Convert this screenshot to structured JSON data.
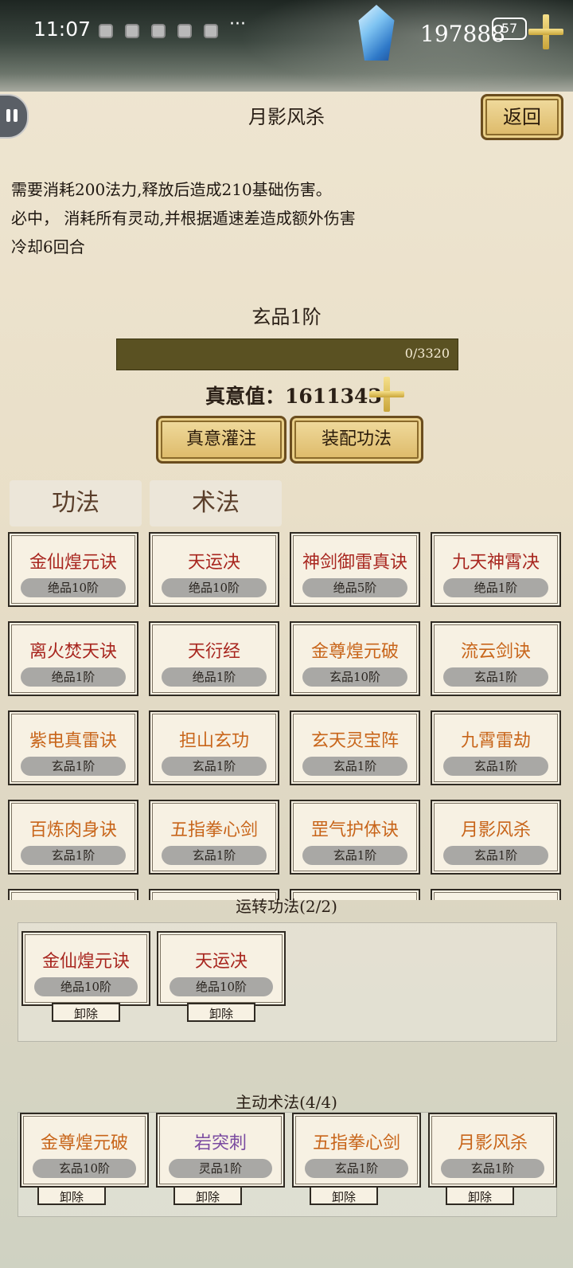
{
  "status_bar": {
    "time": "11:07",
    "more": "···",
    "battery": "57"
  },
  "currency": {
    "amount": "197888"
  },
  "header": {
    "title": "月影风杀",
    "back_label": "返回"
  },
  "skill": {
    "description": [
      "需要消耗200法力,释放后造成210基础伤害。",
      "必中， 消耗所有灵动,并根据遁速差造成额外伤害",
      "冷却6回合"
    ],
    "rank": "玄品1阶",
    "progress_text": "0/3320",
    "progress_fraction": 0.0,
    "true_value_label": "真意值：",
    "true_value": "1611343"
  },
  "actions": {
    "infuse_label": "真意灌注",
    "equip_label": "装配功法"
  },
  "tabs": [
    {
      "label": "功法"
    },
    {
      "label": "术法"
    }
  ],
  "skills_grid": [
    {
      "name": "金仙煌元诀",
      "grade": "绝品10阶",
      "color": "#a8261f"
    },
    {
      "name": "天运决",
      "grade": "绝品10阶",
      "color": "#a8261f"
    },
    {
      "name": "神剑御雷真诀",
      "grade": "绝品5阶",
      "color": "#a8261f"
    },
    {
      "name": "九天神霄决",
      "grade": "绝品1阶",
      "color": "#a8261f"
    },
    {
      "name": "离火焚天诀",
      "grade": "绝品1阶",
      "color": "#a8261f"
    },
    {
      "name": "天衍经",
      "grade": "绝品1阶",
      "color": "#a8261f"
    },
    {
      "name": "金尊煌元破",
      "grade": "玄品10阶",
      "color": "#c8651a"
    },
    {
      "name": "流云剑诀",
      "grade": "玄品1阶",
      "color": "#c8651a"
    },
    {
      "name": "紫电真雷诀",
      "grade": "玄品1阶",
      "color": "#c8651a"
    },
    {
      "name": "担山玄功",
      "grade": "玄品1阶",
      "color": "#c8651a"
    },
    {
      "name": "玄天灵宝阵",
      "grade": "玄品1阶",
      "color": "#c8651a"
    },
    {
      "name": "九霄雷劫",
      "grade": "玄品1阶",
      "color": "#c8651a"
    },
    {
      "name": "百炼肉身诀",
      "grade": "玄品1阶",
      "color": "#c8651a"
    },
    {
      "name": "五指拳心剑",
      "grade": "玄品1阶",
      "color": "#c8651a"
    },
    {
      "name": "罡气护体诀",
      "grade": "玄品1阶",
      "color": "#c8651a"
    },
    {
      "name": "月影风杀",
      "grade": "玄品1阶",
      "color": "#c8651a"
    },
    {
      "name": "",
      "grade": "",
      "color": "#c8651a"
    },
    {
      "name": "",
      "grade": "",
      "color": "#c8651a"
    },
    {
      "name": "",
      "grade": "",
      "color": "#c8651a"
    },
    {
      "name": "",
      "grade": "",
      "color": "#c8651a"
    }
  ],
  "running": {
    "title": "运转功法(2/2)",
    "items": [
      {
        "name": "金仙煌元诀",
        "grade": "绝品10阶",
        "color": "#a8261f",
        "unequip": "卸除"
      },
      {
        "name": "天运决",
        "grade": "绝品10阶",
        "color": "#a8261f",
        "unequip": "卸除"
      }
    ]
  },
  "active": {
    "title": "主动术法(4/4)",
    "items": [
      {
        "name": "金尊煌元破",
        "grade": "玄品10阶",
        "color": "#c8651a",
        "unequip": "卸除"
      },
      {
        "name": "岩突刺",
        "grade": "灵品1阶",
        "color": "#7a4aa0",
        "unequip": "卸除"
      },
      {
        "name": "五指拳心剑",
        "grade": "玄品1阶",
        "color": "#c8651a",
        "unequip": "卸除"
      },
      {
        "name": "月影风杀",
        "grade": "玄品1阶",
        "color": "#c8651a",
        "unequip": "卸除"
      }
    ]
  }
}
